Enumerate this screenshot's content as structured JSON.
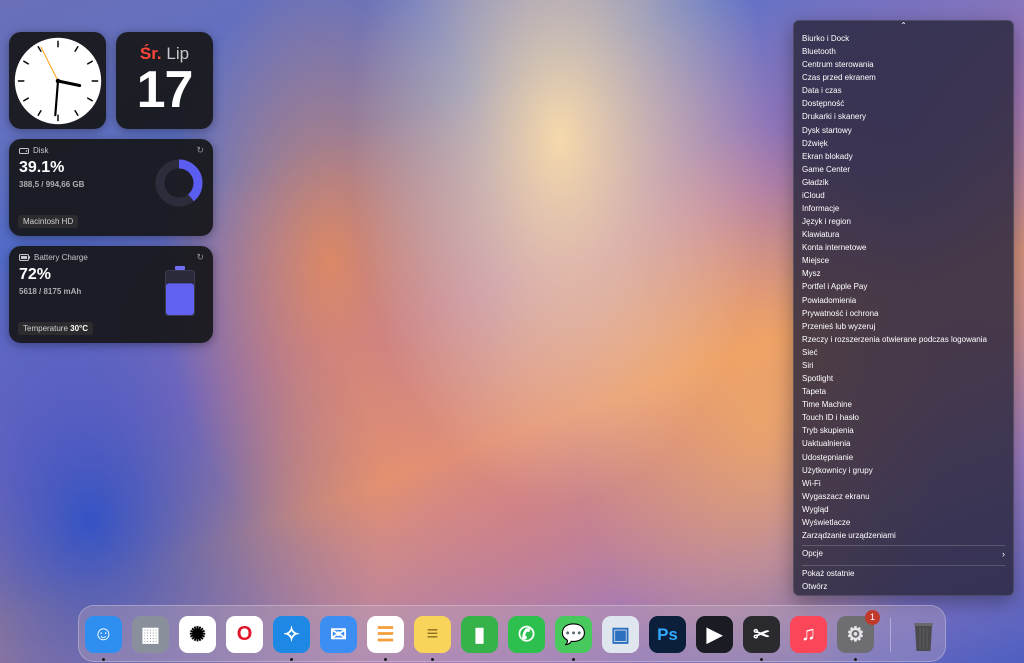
{
  "widgets": {
    "calendar": {
      "day": "Śr.",
      "month": "Lip",
      "date": "17"
    },
    "disk": {
      "title": "Disk",
      "percent": "39.1%",
      "usage": "388,5 / 994,66 GB",
      "volume": "Macintosh HD",
      "used_fraction": 0.391
    },
    "battery": {
      "title": "Battery Charge",
      "percent": "72%",
      "capacity": "5618 / 8175 mAh",
      "temp_label": "Temperature",
      "temp_value": "30°C",
      "level_fraction": 0.72
    }
  },
  "menu": {
    "items": [
      "Biurko i Dock",
      "Bluetooth",
      "Centrum sterowania",
      "Czas przed ekranem",
      "Data i czas",
      "Dostępność",
      "Drukarki i skanery",
      "Dysk startowy",
      "Dźwięk",
      "Ekran blokady",
      "Game Center",
      "Gładzik",
      "iCloud",
      "Informacje",
      "Język i region",
      "Klawiatura",
      "Konta internetowe",
      "Miejsce",
      "Mysz",
      "Portfel i Apple Pay",
      "Powiadomienia",
      "Prywatność i ochrona",
      "Przenieś lub wyzeruj",
      "Rzeczy i rozszerzenia otwierane podczas logowania",
      "Sieć",
      "Siri",
      "Spotlight",
      "Tapeta",
      "Time Machine",
      "Touch ID i hasło",
      "Tryb skupienia",
      "Uaktualnienia",
      "Udostępnianie",
      "Użytkownicy i grupy",
      "Wi-Fi",
      "Wygaszacz ekranu",
      "Wygląd",
      "Wyświetlacze",
      "Zarządzanie urządzeniami"
    ],
    "options": "Opcje",
    "show_recent": "Pokaż ostatnie",
    "open": "Otwórz"
  },
  "dock": {
    "apps": [
      {
        "name": "finder",
        "color": "#2f8ff0",
        "running": true
      },
      {
        "name": "launchpad",
        "color": "#8a8f9c",
        "running": false
      },
      {
        "name": "chatgpt",
        "color": "#ffffff",
        "running": false
      },
      {
        "name": "opera",
        "color": "#ffffff",
        "running": false
      },
      {
        "name": "safari",
        "color": "#1e88e5",
        "running": true
      },
      {
        "name": "mail",
        "color": "#3c8ef3",
        "running": false
      },
      {
        "name": "reminders",
        "color": "#ffffff",
        "running": true
      },
      {
        "name": "notes",
        "color": "#f9d45b",
        "running": true
      },
      {
        "name": "numbers",
        "color": "#35b24a",
        "running": false
      },
      {
        "name": "whatsapp",
        "color": "#2dc04f",
        "running": false
      },
      {
        "name": "messages",
        "color": "#47c95e",
        "running": true
      },
      {
        "name": "preview",
        "color": "#dfe6ee",
        "running": false
      },
      {
        "name": "photoshop",
        "color": "#0b1f3a",
        "running": false
      },
      {
        "name": "infuse",
        "color": "#1b1b24",
        "running": false
      },
      {
        "name": "final-cut-pro",
        "color": "#2a2a2e",
        "running": true
      },
      {
        "name": "music",
        "color": "#fb4558",
        "running": false
      },
      {
        "name": "system-settings",
        "color": "#6d6d72",
        "running": true,
        "badge": "1"
      }
    ],
    "ps_label": "Ps"
  }
}
